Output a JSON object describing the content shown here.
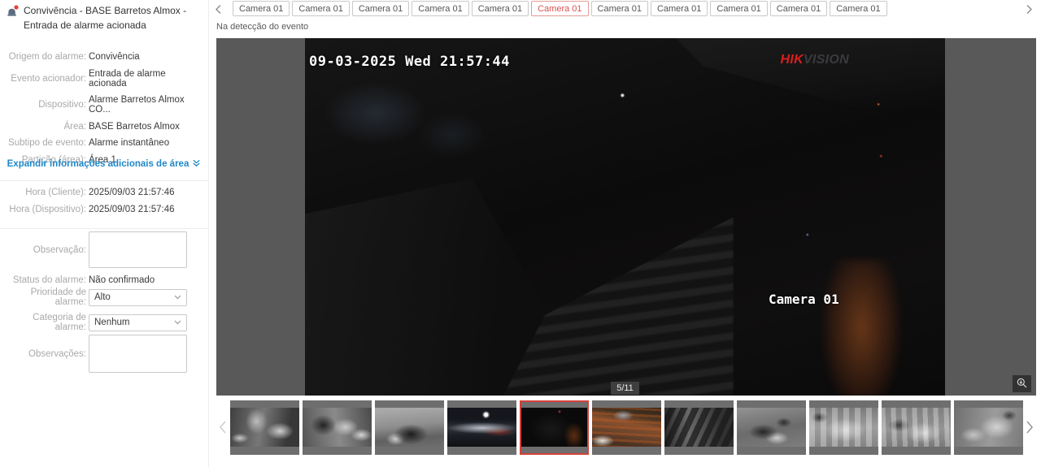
{
  "colors": {
    "accent_red": "#d9534f",
    "link_blue": "#1e88c7",
    "hikvision_red": "#d81f1f",
    "selected_thumb_border": "#d4403a",
    "stage_gray": "#595959"
  },
  "alarm_panel": {
    "icon": "alarm-device-red-dot-icon",
    "title": "Convivência - BASE Barretos Almox - Entrada de alarme acionada",
    "info_fields": [
      {
        "label": "Origem do alarme:",
        "value": "Convivência"
      },
      {
        "label": "Evento acionador:",
        "value": "Entrada de alarme acionada"
      },
      {
        "label": "Dispositivo:",
        "value": "Alarme Barretos Almox CO..."
      },
      {
        "label": "Área:",
        "value": "BASE Barretos Almox"
      },
      {
        "label": "Subtipo de evento:",
        "value": "Alarme instantâneo"
      },
      {
        "label": "Partição (área):",
        "value": "Área 1"
      }
    ],
    "expand_link": {
      "label": "Expandir informações adicionais de área",
      "icon": "double-chevron-down-icon"
    },
    "time_fields": [
      {
        "label": "Hora (Cliente):",
        "value": "2025/09/03 21:57:46"
      },
      {
        "label": "Hora (Dispositivo):",
        "value": "2025/09/03 21:57:46"
      }
    ],
    "observation": {
      "label": "Observação:",
      "value": ""
    },
    "status": {
      "label": "Status do alarme:",
      "value": "Não confirmado"
    },
    "priority": {
      "label": "Prioridade de alarme:",
      "value": "Alto",
      "icon": "chevron-down-icon"
    },
    "category": {
      "label": "Categoria de alarme:",
      "value": "Nenhum",
      "icon": "chevron-down-icon"
    },
    "observations": {
      "label": "Observações:",
      "value": ""
    }
  },
  "camera_tabs": {
    "prev_icon": "chevron-left-icon",
    "next_icon": "chevron-right-icon",
    "items": [
      {
        "label": "Camera 01"
      },
      {
        "label": "Camera 01"
      },
      {
        "label": "Camera 01"
      },
      {
        "label": "Camera 01"
      },
      {
        "label": "Camera 01"
      },
      {
        "label": "Camera 01",
        "active": true
      },
      {
        "label": "Camera 01"
      },
      {
        "label": "Camera 01"
      },
      {
        "label": "Camera 01"
      },
      {
        "label": "Camera 01"
      },
      {
        "label": "Camera 01"
      }
    ]
  },
  "event_phase_label": "Na detecção do evento",
  "video": {
    "osd_timestamp": "09-03-2025 Wed 21:57:44",
    "watermark": {
      "part1": "HIK",
      "part2": "VISION"
    },
    "osd_camera_name": "Camera 01",
    "frame_counter": "5/11",
    "zoom_button_icon": "magnifier-zoom-icon"
  },
  "thumbnail_strip": {
    "prev_icon": "chevron-left-icon",
    "next_icon": "chevron-right-icon",
    "items": [
      {
        "scene": "storage-shelves-ir"
      },
      {
        "scene": "storage-room-ir"
      },
      {
        "scene": "garage-motorcycle-ir"
      },
      {
        "scene": "parking-lot-night-floodlight"
      },
      {
        "scene": "dark-entrance-night",
        "selected": true
      },
      {
        "scene": "yard-pallets-color"
      },
      {
        "scene": "stairwell-shelves-ir"
      },
      {
        "scene": "office-room-ir"
      },
      {
        "scene": "warehouse-boxes-ir"
      },
      {
        "scene": "warehouse-boxes-ir"
      },
      {
        "scene": "warehouse-stock-ir"
      }
    ]
  }
}
